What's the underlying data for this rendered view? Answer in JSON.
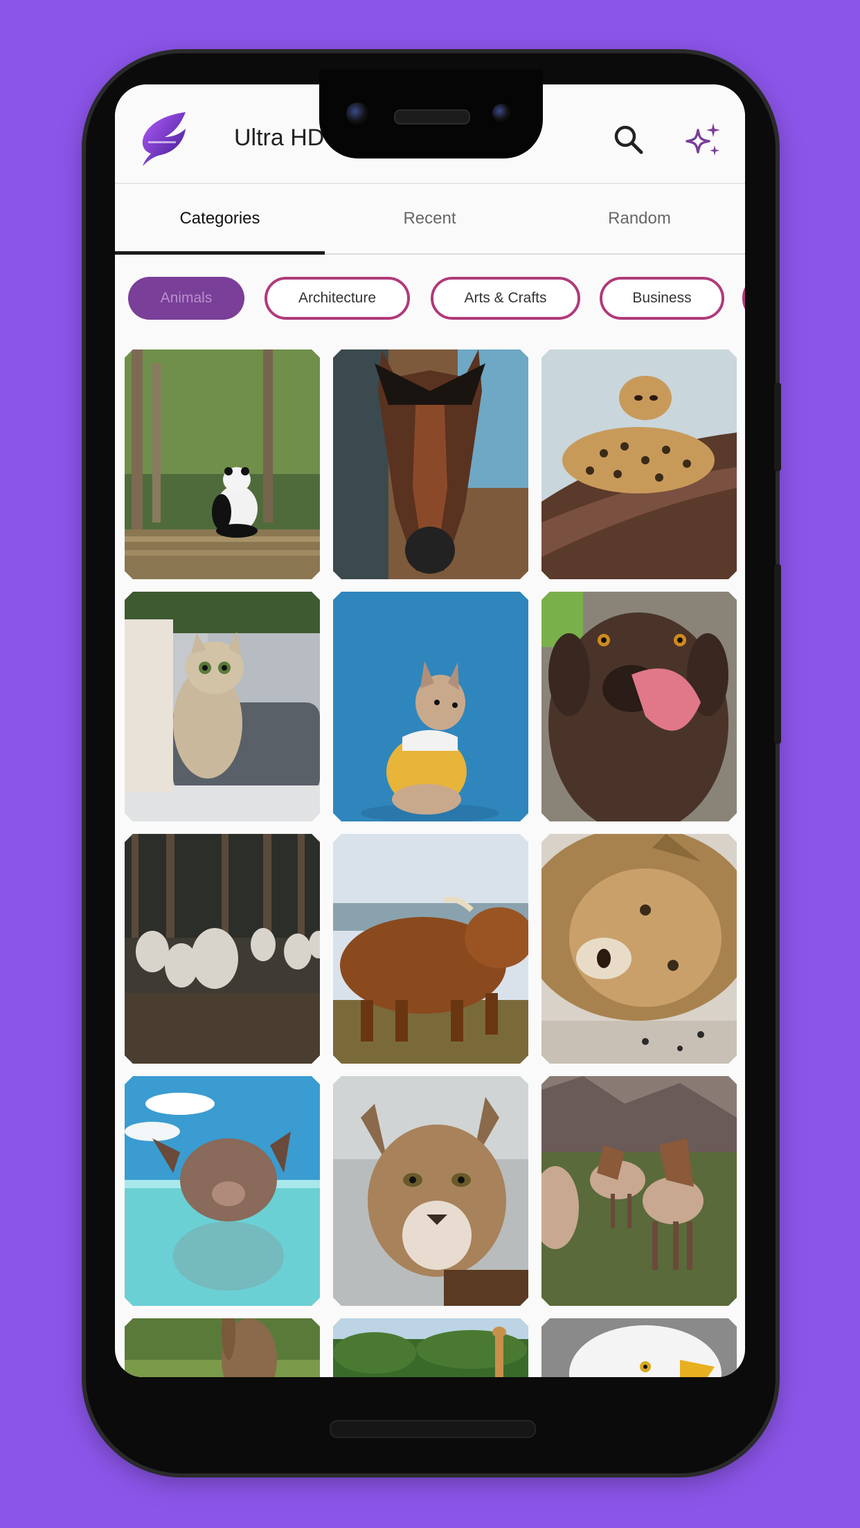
{
  "app": {
    "title": "Ultra HD",
    "logo_icon": "feather-logo-icon"
  },
  "toolbar": {
    "search_icon": "search-icon",
    "sparkle_icon": "sparkle-icon"
  },
  "tabs": [
    {
      "label": "Categories",
      "active": true
    },
    {
      "label": "Recent",
      "active": false
    },
    {
      "label": "Random",
      "active": false
    }
  ],
  "chips": [
    {
      "label": "Animals",
      "selected": true
    },
    {
      "label": "Architecture",
      "selected": false
    },
    {
      "label": "Arts & Crafts",
      "selected": false
    },
    {
      "label": "Business",
      "selected": false
    }
  ],
  "wallpapers": [
    {
      "subject": "panda"
    },
    {
      "subject": "horse"
    },
    {
      "subject": "leopard"
    },
    {
      "subject": "kitten"
    },
    {
      "subject": "french-bulldog"
    },
    {
      "subject": "chocolate-labrador"
    },
    {
      "subject": "sheep"
    },
    {
      "subject": "highland-cow"
    },
    {
      "subject": "lion"
    },
    {
      "subject": "swimming-pig"
    },
    {
      "subject": "cougar"
    },
    {
      "subject": "ponies"
    },
    {
      "subject": "rabbit"
    },
    {
      "subject": "giraffe"
    },
    {
      "subject": "eagle"
    }
  ],
  "colors": {
    "background": "#8c55ea",
    "accent": "#7a3f98",
    "chip_border": "#b03a7a"
  }
}
